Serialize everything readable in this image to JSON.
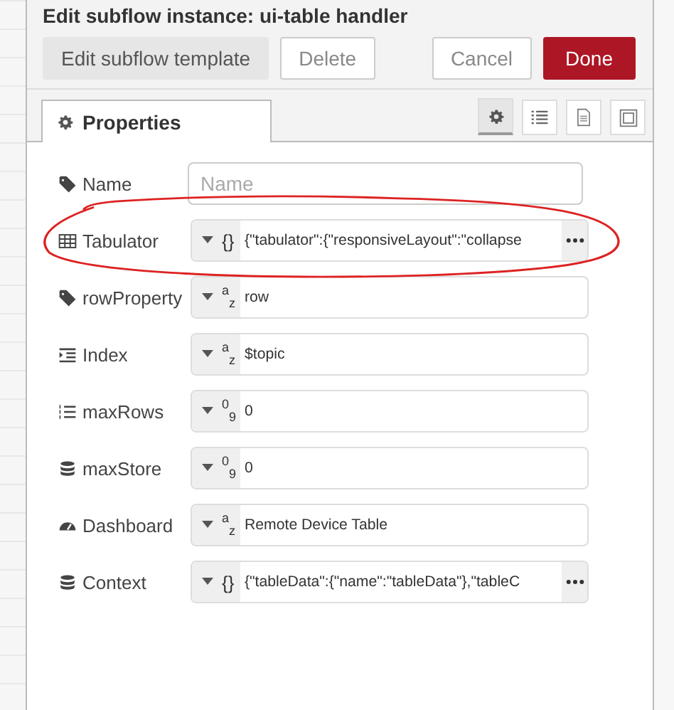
{
  "dialog": {
    "title": "Edit subflow instance: ui-table handler"
  },
  "buttons": [
    {
      "label": "Edit subflow template",
      "kind": "secondary"
    },
    {
      "label": "Delete",
      "kind": "plain"
    },
    {
      "label": "Cancel",
      "kind": "plain"
    },
    {
      "label": "Done",
      "kind": "primary"
    }
  ],
  "tabs": [
    {
      "label": "Properties",
      "selected": true
    }
  ],
  "side_tabs": [
    {
      "selected": true
    },
    {
      "selected": false
    },
    {
      "selected": false
    },
    {
      "selected": false
    }
  ],
  "fields": [
    {
      "label": "Name",
      "kind": "text",
      "placeholder": "Name"
    },
    {
      "label": "Tabulator",
      "kind": "typed",
      "type_label": "{}",
      "value": "{\"tabulator\":{\"responsiveLayout\":\"collapse",
      "expand": true
    },
    {
      "label": "rowProperty",
      "kind": "typed",
      "type_label": "$^{a}$$_{z}$",
      "value": "row",
      "expand": false
    },
    {
      "label": "Index",
      "kind": "typed",
      "type_label": "$^{a}$$_{z}$",
      "value": "$topic",
      "expand": false
    },
    {
      "label": "maxRows",
      "kind": "typed",
      "type_label": "$^{0}$$_{9}$",
      "value": "0",
      "expand": false
    },
    {
      "label": "maxStore",
      "kind": "typed",
      "type_label": "$^{0}$$_{9}$",
      "value": "0",
      "expand": false
    },
    {
      "label": "Dashboard",
      "kind": "typed",
      "type_label": "$^{a}$$_{z}$",
      "value": "Remote Device Table",
      "expand": false
    },
    {
      "label": "Context",
      "kind": "typed",
      "type_label": "{}",
      "value": "{\"tableData\":{\"name\":\"tableData\"},\"tableC",
      "expand": true
    }
  ]
}
